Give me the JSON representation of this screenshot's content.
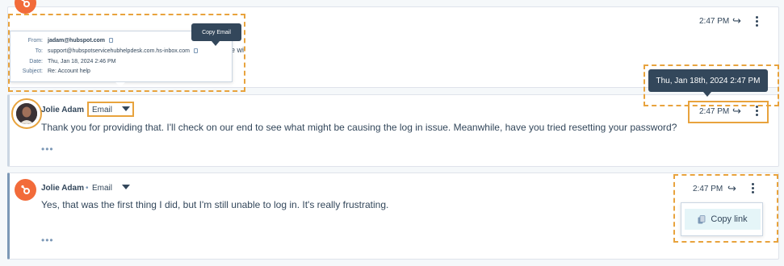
{
  "message1": {
    "time": "2:47 PM",
    "details": {
      "from_label": "From:",
      "from_value": "jadam@hubspot.com",
      "to_label": "To:",
      "to_value": "support@hubspotservicehubhelpdesk.com.hs-inbox.com",
      "date_label": "Date:",
      "date_value": "Thu, Jan 18, 2024 2:46 PM",
      "subject_label": "Subject:",
      "subject_value": "Re: Account help"
    },
    "truncated_text": "e wi",
    "copy_email_tooltip": "Copy Email"
  },
  "message2": {
    "sender": "Jolie Adam",
    "channel": "Email",
    "body": "Thank you for providing that. I'll check on our end to see what might be causing the log in issue. Meanwhile, have you tried resetting your password?",
    "time": "2:47 PM",
    "timestamp_tooltip": "Thu, Jan 18th, 2024 2:47 PM",
    "ellipsis": "•••"
  },
  "message3": {
    "sender": "Jolie Adam",
    "separator": "•",
    "channel": "Email",
    "body": "Yes, that was the first thing I did, but I'm still unable to log in. It's really frustrating.",
    "time": "2:47 PM",
    "ellipsis": "•••",
    "copy_link_label": "Copy link"
  },
  "colors": {
    "accent_orange": "#e8a33d",
    "hubspot_orange": "#f26b3a",
    "text": "#33475b",
    "tooltip_bg": "#33475b"
  },
  "icons": [
    "hubspot-sprocket-icon",
    "forward-icon",
    "kebab-menu-icon",
    "copy-icon",
    "caret-down-icon"
  ]
}
